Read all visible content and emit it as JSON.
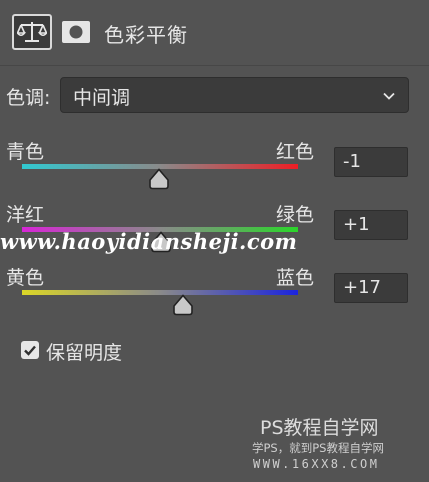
{
  "header": {
    "title": "色彩平衡",
    "icons": [
      "balance-scale-icon",
      "layer-mask-icon"
    ]
  },
  "tone": {
    "label": "色调:",
    "selected": "中间调"
  },
  "sliders": [
    {
      "left_label": "青色",
      "right_label": "红色",
      "value": "-1",
      "level": -1,
      "gradient": [
        "#31c9d1",
        "#ee1e25"
      ]
    },
    {
      "left_label": "洋红",
      "right_label": "绿色",
      "value": "+1",
      "level": 1,
      "gradient": [
        "#d726d6",
        "#2bd62a"
      ]
    },
    {
      "left_label": "黄色",
      "right_label": "蓝色",
      "value": "+17",
      "level": 17,
      "gradient": [
        "#dcd727",
        "#1b24dd"
      ]
    }
  ],
  "preserve_luminosity": {
    "label": "保留明度",
    "checked": true
  },
  "watermarks": {
    "url": "www.haoyidiansheji.com",
    "brand": "PS教程自学网",
    "sub": "学PS，就到PS教程自学网",
    "site": "WWW.16XX8.COM"
  }
}
